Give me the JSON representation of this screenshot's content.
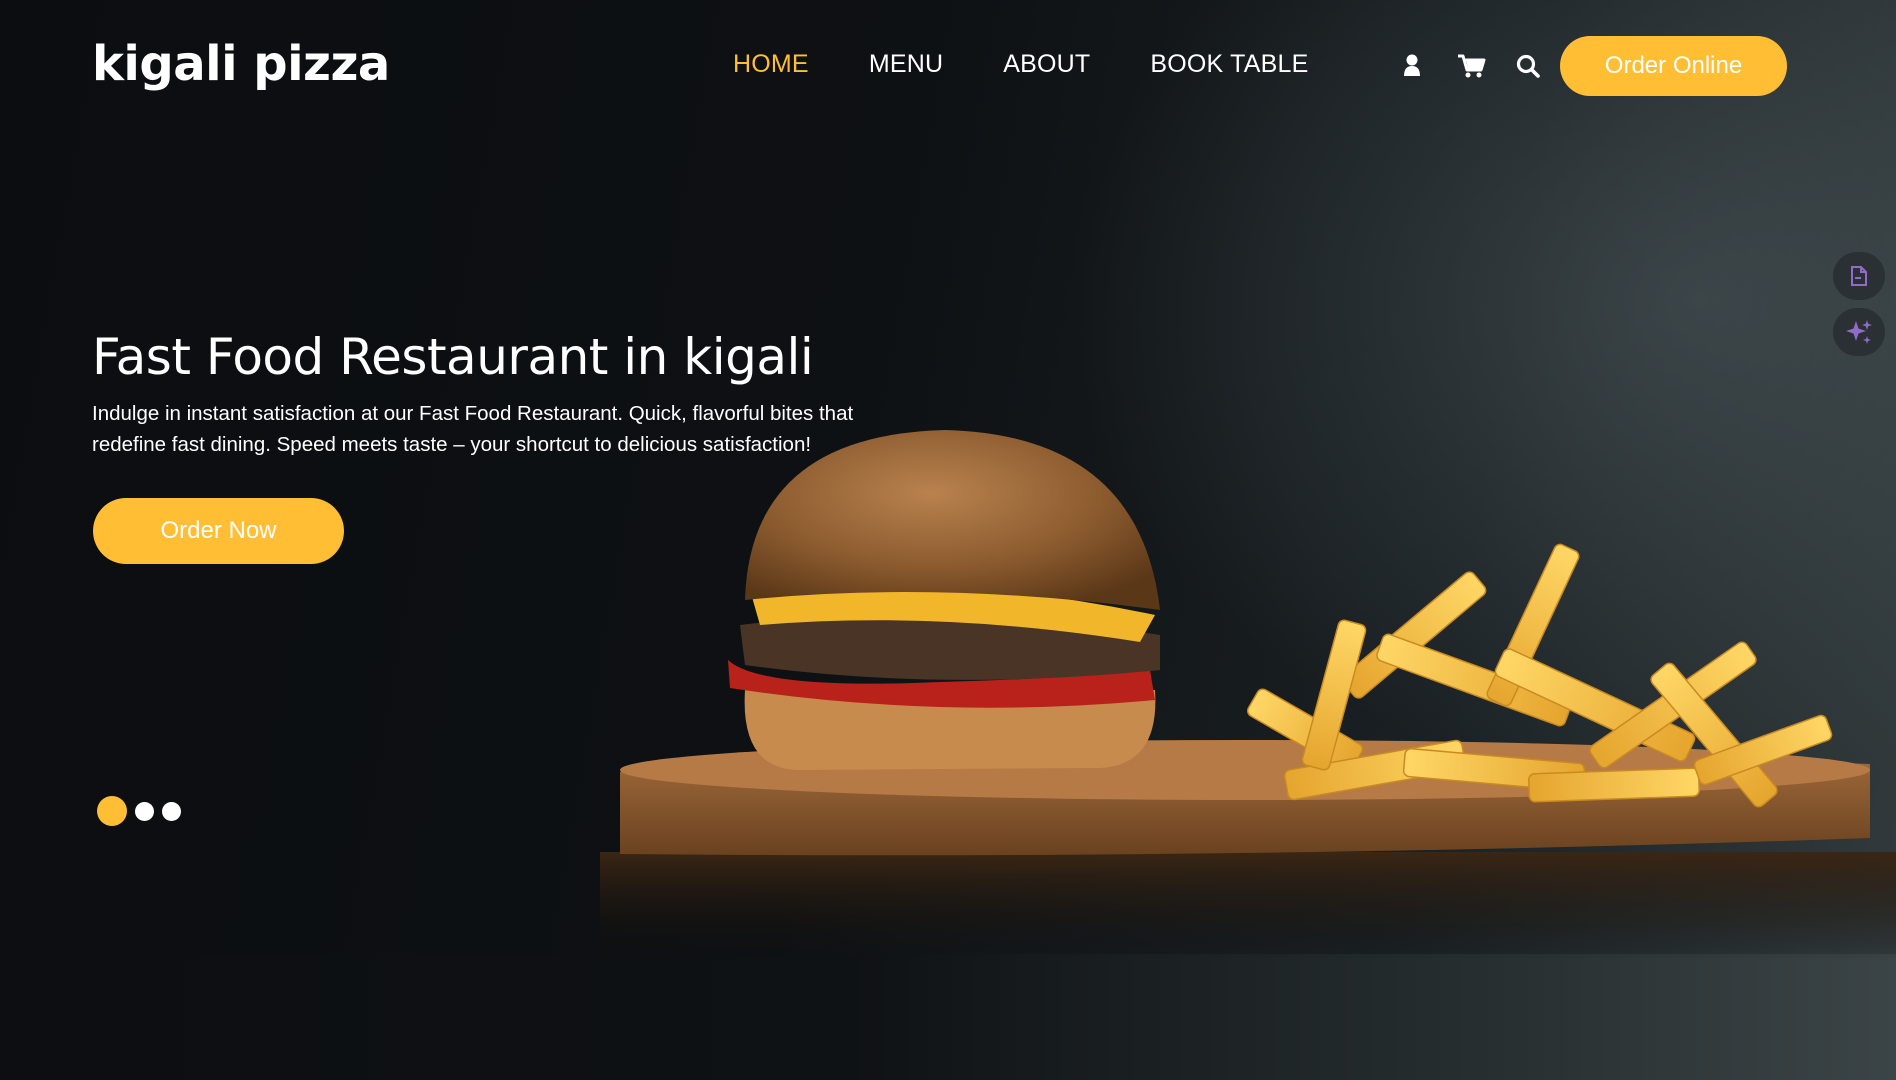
{
  "brand": {
    "name": "kigali pizza"
  },
  "nav": {
    "items": [
      {
        "label": "HOME",
        "active": true
      },
      {
        "label": "MENU",
        "active": false
      },
      {
        "label": "ABOUT",
        "active": false
      },
      {
        "label": "BOOK TABLE",
        "active": false
      }
    ]
  },
  "header_icons": [
    "user-icon",
    "cart-icon",
    "search-icon"
  ],
  "header": {
    "order_online_label": "Order Online"
  },
  "hero": {
    "title": "Fast Food Restaurant in kigali",
    "description": "Indulge in instant satisfaction at our Fast Food Restaurant. Quick, flavorful bites that redefine fast dining. Speed meets taste – your shortcut to delicious satisfaction!",
    "cta_label": "Order Now"
  },
  "slider": {
    "total": 3,
    "active_index": 0
  },
  "side_tools": [
    "document-icon",
    "sparkle-icon"
  ],
  "colors": {
    "accent": "#ffbe33",
    "background": "#0d0f12",
    "text": "#ffffff"
  }
}
